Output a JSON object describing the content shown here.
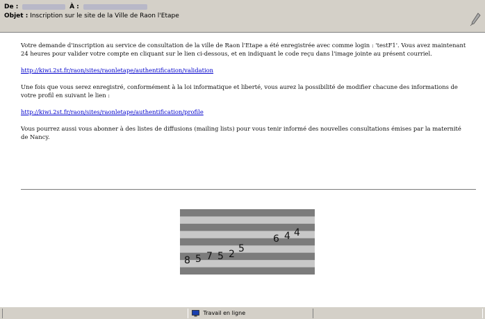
{
  "header": {
    "from_label": "De :",
    "to_label": "À :",
    "subject_label": "Objet :",
    "subject": "Inscription sur le site de la Ville de Raon l'Etape"
  },
  "message": {
    "paragraph1": "Votre demande d'inscription au service de consultation de la ville de Raon l'Etape a été enregistrée avec comme login : 'testF1'. Vous avez maintenant 24 heures pour valider votre compte en cliquant sur le lien ci-dessous, et en indiquant le code reçu dans l'image jointe au présent courriel.",
    "link1": "http://kiwi.2st.fr/raon/sites/raonletape/authentification/validation",
    "paragraph2": "Une fois que vous serez enregistré, conformément à la loi informatique et liberté, vous aurez la possibilité de modifier chacune des informations de votre profil en suivant le lien :",
    "link2": "http://kiwi.2st.fr/raon/sites/raonletape/authentification/profile",
    "paragraph3": "Vous pourrez aussi vous abonner à des listes de diffusions (mailing lists) pour vous tenir informé des nouvelles consultations émises par la maternité de Nancy."
  },
  "captcha": {
    "digits": [
      "8",
      "5",
      "7",
      "5",
      "2",
      "5",
      "6",
      "4",
      "4"
    ],
    "stripe_dark": "#7c7c7c",
    "stripe_light": "#c8c8c8"
  },
  "statusbar": {
    "online_text": "Travail en ligne"
  }
}
